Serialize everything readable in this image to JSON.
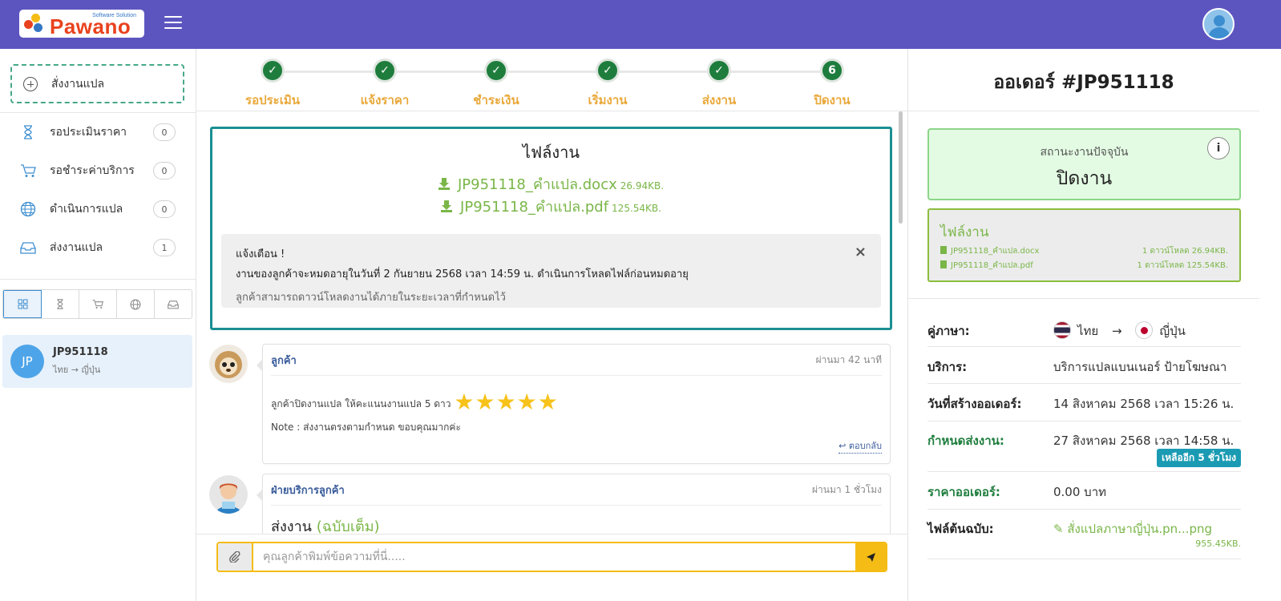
{
  "header": {
    "logo_text": "Pawano",
    "logo_sub": "Software Solution"
  },
  "sidebar": {
    "new_order_label": "สั่งงานแปล",
    "menu": [
      {
        "label": "รอประเมินราคา",
        "count": "0",
        "icon": "hourglass-icon"
      },
      {
        "label": "รอชำระค่าบริการ",
        "count": "0",
        "icon": "cart-icon"
      },
      {
        "label": "ดำเนินการแปล",
        "count": "0",
        "icon": "globe-icon"
      },
      {
        "label": "ส่งงานแปล",
        "count": "1",
        "icon": "inbox-icon"
      }
    ],
    "filter_tabs": [
      "grid-icon",
      "hourglass-icon",
      "cart-icon",
      "globe-icon",
      "inbox-icon"
    ],
    "order_card": {
      "avatar": "JP",
      "title": "JP951118",
      "subtitle": "ไทย → ญี่ปุ่น"
    }
  },
  "stepper": {
    "steps": [
      {
        "label": "รอประเมิน",
        "mark": "✓"
      },
      {
        "label": "แจ้งราคา",
        "mark": "✓"
      },
      {
        "label": "ชำระเงิน",
        "mark": "✓"
      },
      {
        "label": "เริ่มงาน",
        "mark": "✓"
      },
      {
        "label": "ส่งงาน",
        "mark": "✓"
      },
      {
        "label": "ปิดงาน",
        "mark": "6"
      }
    ]
  },
  "files_panel": {
    "title": "ไฟล์งาน",
    "files": [
      {
        "name": "JP951118_คำแปล.docx",
        "size": "26.94KB."
      },
      {
        "name": "JP951118_คำแปล.pdf",
        "size": "125.54KB."
      }
    ],
    "alert": {
      "title": "แจ้งเตือน !",
      "line1": "งานของลูกค้าจะหมดอายุในวันที่ 2 กันยายน 2568 เวลา 14:59 น. ดำเนินการโหลดไฟล์ก่อนหมดอายุ",
      "line2": "ลูกค้าสามารถดาวน์โหลดงานได้ภายในระยะเวลาที่กำหนดไว้"
    }
  },
  "messages": [
    {
      "name": "ลูกค้า",
      "time": "ผ่านมา 42 นาที",
      "text": "ลูกค้าปิดงานแปล ให้คะแนนงานแปล 5 ดาว",
      "stars": "★★★★★",
      "rating": 5,
      "note": "Note : ส่งงานตรงตามกำหนด ขอบคุณมากค่ะ",
      "reply": "ตอบกลับ"
    },
    {
      "name": "ฝ่ายบริการลูกค้า",
      "time": "ผ่านมา 1 ชั่วโมง",
      "title": "ส่งงาน",
      "title_extra": "(ฉบับเต็ม)"
    }
  ],
  "composer": {
    "placeholder": "คุณลูกค้าพิมพ์ข้อความที่นี่....."
  },
  "order": {
    "title": "ออเดอร์ #JP951118",
    "status_label": "สถานะงานปัจจุบัน",
    "status_value": "ปิดงาน",
    "files_title": "ไฟล์งาน",
    "files": [
      {
        "name": "JP951118_คำแปล.docx",
        "meta": "1 ดาวน์โหลด 26.94KB."
      },
      {
        "name": "JP951118_คำแปล.pdf",
        "meta": "1 ดาวน์โหลด 125.54KB."
      }
    ],
    "details": {
      "lang_label": "คู่ภาษา:",
      "lang_from": "ไทย",
      "arrow": "→",
      "lang_to": "ญี่ปุ่น",
      "service_label": "บริการ:",
      "service_value": "บริการแปลแบนเนอร์ ป้ายโฆษณา",
      "created_label": "วันที่สร้างออเดอร์:",
      "created_value": "14 สิงหาคม 2568 เวลา 15:26 น.",
      "deadline_label": "กำหนดส่งงาน:",
      "deadline_value": "27 สิงหาคม 2568 เวลา 14:58 น.",
      "deadline_badge": "เหลืออีก 5 ชั่วโมง",
      "price_label": "ราคาออเดอร์:",
      "price_value": "0.00 บาท",
      "source_label": "ไฟล์ต้นฉบับ:",
      "source_value": "สั่งแปลภาษาญี่ปุ่น.pn...png",
      "source_size": "955.45KB."
    }
  },
  "colors": {
    "header": "#5c55bf",
    "accent_green": "#7ab648",
    "step_done": "#1e7d3d",
    "step_label": "#e9a83a",
    "teal": "#1b8f93",
    "yellow": "#f5bc16"
  }
}
